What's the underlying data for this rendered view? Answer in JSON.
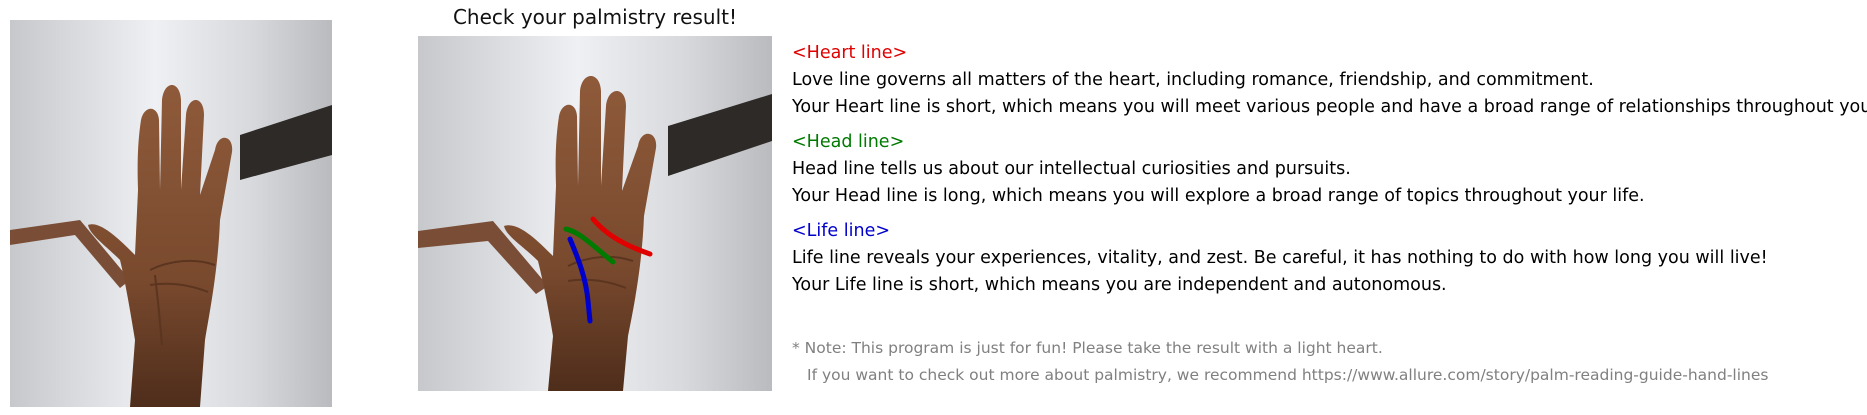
{
  "title": "Check your palmistry result!",
  "colors": {
    "heart": "#e00000",
    "head": "#007a00",
    "life": "#0000cc",
    "note": "#808080"
  },
  "images": {
    "original": "hand-photo",
    "annotated": "hand-photo-with-lines"
  },
  "sections": [
    {
      "heading": "<Heart line>",
      "description": "Love line governs all matters of the heart, including romance, friendship, and commitment.",
      "result": "Your Heart line is short, which means you will meet various people and have a broad range of relationships throughout your life."
    },
    {
      "heading": "<Head line>",
      "description": "Head line tells us about our intellectual curiosities and pursuits.",
      "result": "Your Head line is long, which means you will explore a broad range of topics throughout your life."
    },
    {
      "heading": "<Life line>",
      "description": "Life line reveals your experiences, vitality, and zest. Be careful, it has nothing to do with how long you will live!",
      "result": "Your Life line is short, which means you are independent and autonomous."
    }
  ],
  "note": {
    "line1": "* Note: This program is just for fun! Please take the result with a light heart.",
    "line2": "If you want to check out more about palmistry, we recommend https://www.allure.com/story/palm-reading-guide-hand-lines"
  }
}
